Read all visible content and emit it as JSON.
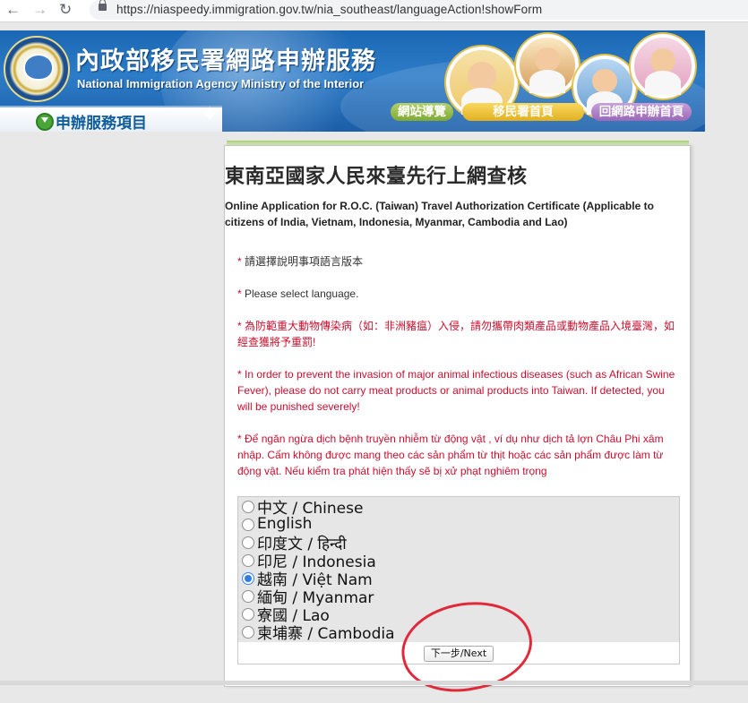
{
  "browser": {
    "url_scheme": "https://",
    "url_rest": "niaspeedy.immigration.gov.tw/nia_southeast/languageAction!showForm"
  },
  "banner": {
    "title_zh": "內政部移民署網路申辦服務",
    "title_en": "National Immigration Agency Ministry of the Interior",
    "services_label": "申辦服務項目",
    "nav": {
      "site_guide": "網站導覽",
      "agency_home": "移民署首頁",
      "return_home": "回網路申辦首頁"
    }
  },
  "page": {
    "title": "東南亞國家人民來臺先行上網查核",
    "subtitle": "Online Application for R.O.C. (Taiwan) Travel Authorization Certificate (Applicable to citizens of India, Vietnam, Indonesia, Myanmar, Cambodia and Lao)",
    "star": "* ",
    "notice_select_zh": "請選擇說明事項語言版本",
    "notice_select_en": "Please select language.",
    "notice_disease_zh": "為防範重大動物傳染病（如：非洲豬瘟）入侵，請勿攜帶肉類產品或動物產品入境臺灣，如經查獲將予重罰!",
    "notice_disease_en": "In order to prevent the invasion of major animal infectious diseases (such as African Swine Fever), please do not carry meat products or animal products into Taiwan. If detected, you will be punished severely!",
    "notice_disease_vi": "Để ngăn ngừa dịch bệnh truyền nhiễm từ động vật , ví dụ như dịch tả lợn Châu Phi xâm nhập. Cấm không được mang theo các sản phẩm từ thịt hoặc các sản phẩm được làm từ động vật. Nếu kiểm tra phát hiện thấy sẽ bị xử phạt nghiêm trọng"
  },
  "languages": [
    {
      "label": "中文 / Chinese",
      "checked": false
    },
    {
      "label": "English",
      "checked": false
    },
    {
      "label": "印度文 / हिन्दी",
      "checked": false
    },
    {
      "label": "印尼 / Indonesia",
      "checked": false
    },
    {
      "label": "越南 / Việt Nam",
      "checked": true
    },
    {
      "label": "緬甸 / Myanmar",
      "checked": false
    },
    {
      "label": "寮國 / Lao",
      "checked": false
    },
    {
      "label": "柬埔寨 / Cambodia",
      "checked": false
    }
  ],
  "form": {
    "next_label": "下一步/Next"
  },
  "colors": {
    "banner_blue": "#1b67b4",
    "notice_red": "#c8102e",
    "annotation_red": "#e02a3a",
    "radio_selected": "#2f7ee6"
  },
  "icons": {
    "back": "arrow-left",
    "forward": "arrow-right",
    "reload": "reload",
    "lock": "lock",
    "services": "down-arrow-circle"
  }
}
